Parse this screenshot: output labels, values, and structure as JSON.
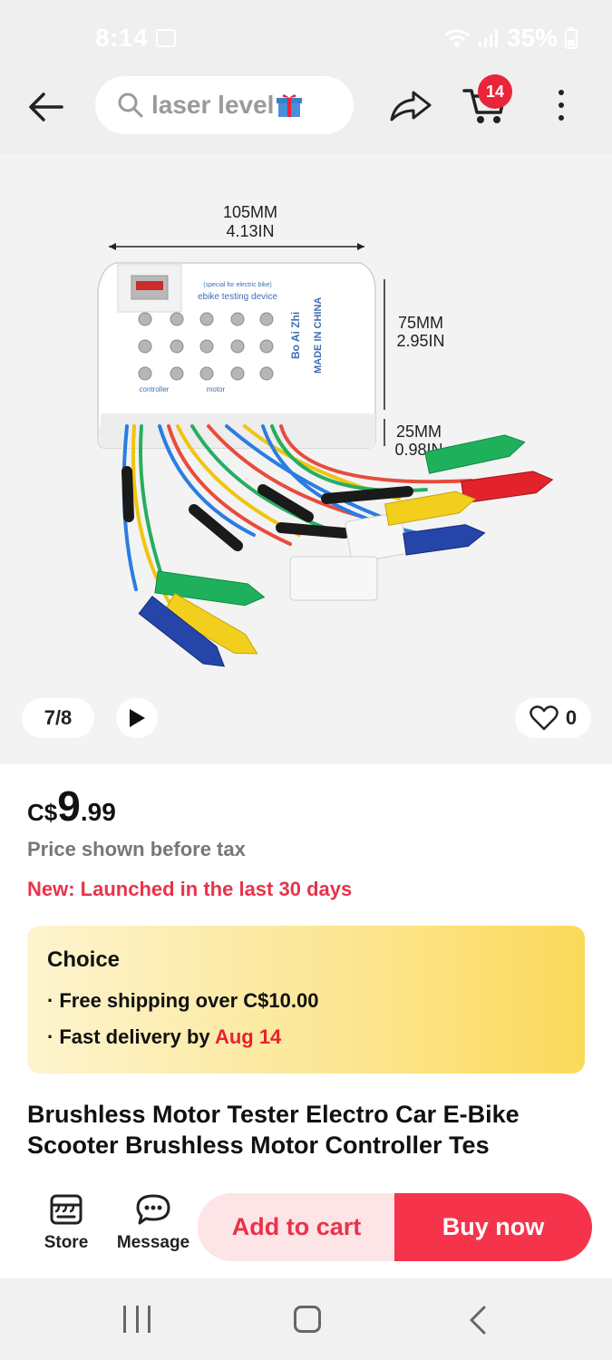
{
  "status": {
    "time": "8:14",
    "battery": "35%"
  },
  "header": {
    "search_text": "laser level",
    "cart_count": "14"
  },
  "gallery": {
    "counter": "7/8",
    "wishlist_count": "0",
    "image_labels": {
      "width_mm": "105MM",
      "width_in": "4.13IN",
      "height_mm": "75MM",
      "height_in": "2.95IN",
      "depth_mm": "25MM",
      "depth_in": "0.98IN",
      "device_subtitle": "(special for electric bike)",
      "device_title": "ebike testing device",
      "brand": "Bo Ai Zhi",
      "made_in": "MADE IN CHINA",
      "label_controller": "controller",
      "label_motor": "motor"
    }
  },
  "price": {
    "currency": "C$",
    "integer": "9",
    "decimal": ".99",
    "note": "Price shown before tax",
    "new_badge": "New: Launched in the last 30 days"
  },
  "choice": {
    "title": "Choice",
    "item1": "Free shipping over C$10.00",
    "item2_prefix": "Fast delivery by ",
    "item2_date": "Aug 14"
  },
  "product": {
    "title": "Brushless Motor Tester Electro Car E-Bike Scooter Brushless Motor Controller Tes"
  },
  "actions": {
    "store": "Store",
    "message": "Message",
    "add_to_cart": "Add to cart",
    "buy_now": "Buy now"
  },
  "colors": {
    "accent_red": "#f5344b",
    "badge_red": "#e8253b",
    "new_text": "#e8334a"
  }
}
